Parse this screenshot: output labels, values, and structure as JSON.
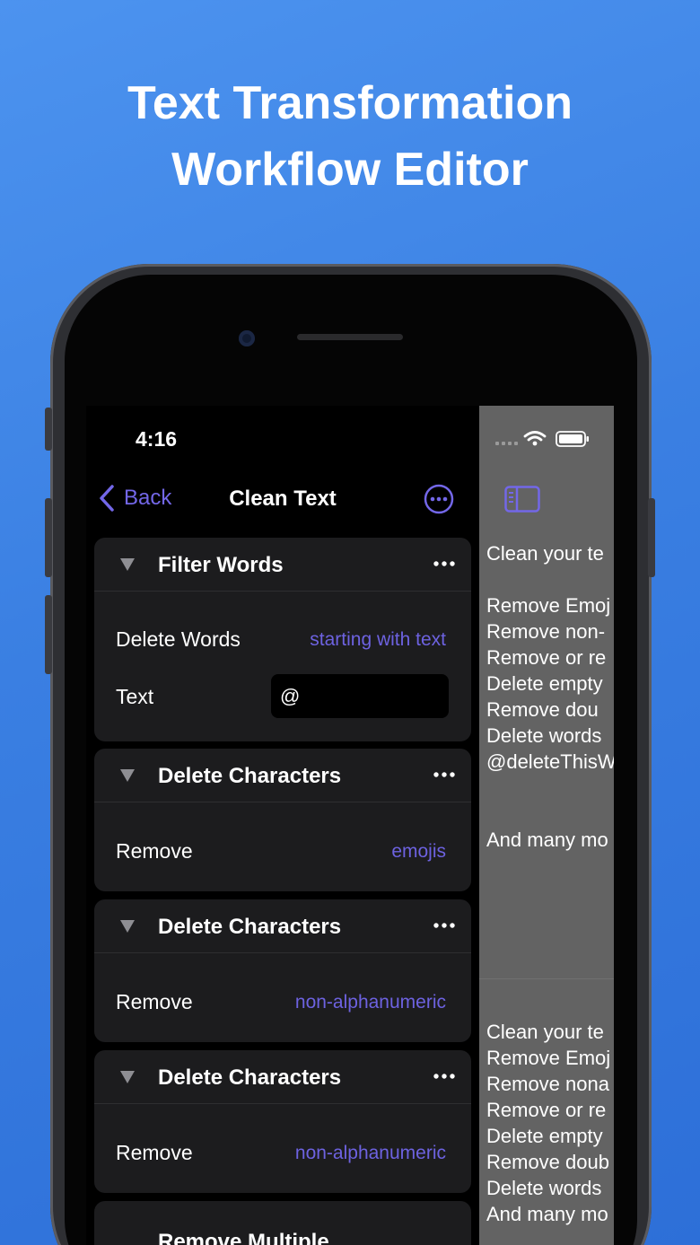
{
  "headline": {
    "line1": "Text Transformation",
    "line2": "Workflow Editor"
  },
  "status": {
    "time": "4:16"
  },
  "nav": {
    "back_label": "Back",
    "title": "Clean Text"
  },
  "cards": [
    {
      "title": "Filter Words",
      "rows": [
        {
          "label": "Delete Words",
          "value": "starting with text"
        },
        {
          "label": "Text",
          "field_value": "@"
        }
      ]
    },
    {
      "title": "Delete Characters",
      "rows": [
        {
          "label": "Remove",
          "value": "emojis"
        }
      ]
    },
    {
      "title": "Delete Characters",
      "rows": [
        {
          "label": "Remove",
          "value": "non-alphanumeric"
        }
      ]
    },
    {
      "title": "Delete Characters",
      "rows": [
        {
          "label": "Remove",
          "value": "non-alphanumeric"
        }
      ]
    },
    {
      "title": "Remove Multiple"
    }
  ],
  "preview_top": [
    "Clean your te",
    "",
    "Remove Emoj",
    "Remove non-",
    "Remove or re",
    "Delete empty",
    "Remove  dou",
    "Delete words",
    "@deleteThisW",
    "",
    "",
    "And many mo"
  ],
  "preview_bottom": [
    "Clean your te",
    "Remove Emoj",
    "Remove nona",
    "Remove or re",
    "Delete empty",
    "Remove doub",
    "Delete words",
    "And many mo"
  ],
  "colors": {
    "accent": "#6d62e0",
    "background_top": "#4c93ef",
    "card": "#1c1c1e"
  }
}
